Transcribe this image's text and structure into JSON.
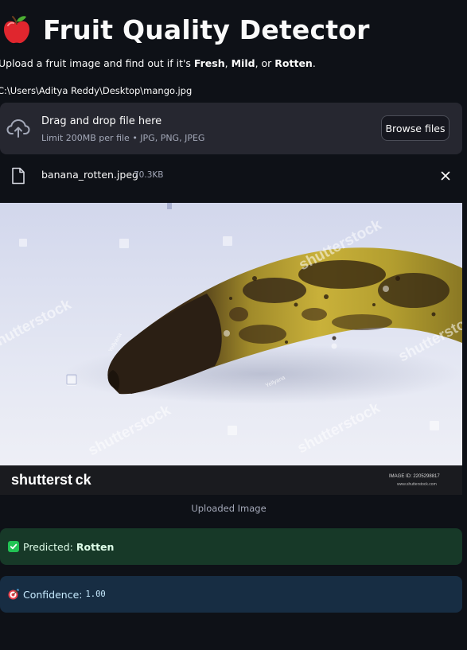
{
  "header": {
    "title": "Fruit Quality Detector",
    "icon": "red-apple-icon"
  },
  "intro": {
    "prefix": "Upload a fruit image and find out if it's ",
    "fresh": "Fresh",
    "sep1": ", ",
    "mild": "Mild",
    "sep2": ", or ",
    "rotten": "Rotten",
    "suffix": "."
  },
  "path_text": "C:\\Users\\Aditya Reddy\\Desktop\\mango.jpg",
  "uploader": {
    "drop_label": "Drag and drop file here",
    "limit_label": "Limit 200MB per file • JPG, PNG, JPEG",
    "browse_label": "Browse files",
    "icon": "cloud-upload-icon"
  },
  "uploaded_file": {
    "name": "banana_rotten.jpeg",
    "size": "70.3KB",
    "icon": "file-icon",
    "remove_icon": "close-icon"
  },
  "image": {
    "watermark": "shutterstock",
    "watermark_mark": "shutterst ck",
    "brand": "shutterst ck",
    "image_id": "IMAGE ID: 2205298817",
    "site": "www.shutterstock.com",
    "photographer": "Yellyana",
    "caption": "Uploaded Image"
  },
  "prediction": {
    "label": "Predicted: ",
    "value": "Rotten",
    "icon": "check-mark-icon",
    "color": "#21c354"
  },
  "confidence": {
    "label": "Confidence: ",
    "value": "1.00",
    "icon": "target-icon"
  },
  "colors": {
    "background": "#0e1117",
    "panel": "#262730",
    "success_bg": "#173928",
    "info_bg": "#172d43"
  }
}
